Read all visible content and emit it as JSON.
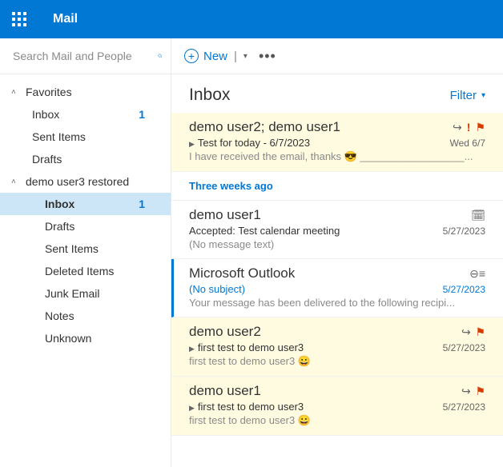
{
  "header": {
    "app_title": "Mail"
  },
  "search": {
    "placeholder": "Search Mail and People"
  },
  "commands": {
    "new_label": "New",
    "divider": "|"
  },
  "sidebar": {
    "sections": [
      {
        "label": "Favorites",
        "folders": [
          {
            "label": "Inbox",
            "count": "1"
          },
          {
            "label": "Sent Items",
            "count": ""
          },
          {
            "label": "Drafts",
            "count": ""
          }
        ]
      },
      {
        "label": "demo user3 restored",
        "folders": [
          {
            "label": "Inbox",
            "count": "1",
            "selected": true
          },
          {
            "label": "Drafts",
            "count": ""
          },
          {
            "label": "Sent Items",
            "count": ""
          },
          {
            "label": "Deleted Items",
            "count": ""
          },
          {
            "label": "Junk Email",
            "count": ""
          },
          {
            "label": "Notes",
            "count": ""
          },
          {
            "label": "Unknown",
            "count": ""
          }
        ]
      }
    ]
  },
  "list": {
    "title": "Inbox",
    "filter_label": "Filter",
    "group_label": "Three weeks ago",
    "messages": [
      {
        "sender": "demo user2; demo user1",
        "subject": "Test for today - 6/7/2023",
        "date": "Wed 6/7",
        "preview": "I have received the email, thanks 😎  __________________...",
        "thread": true,
        "reply": true,
        "importance": true,
        "flag": true
      },
      {
        "sender": "demo user1",
        "subject": "Accepted: Test calendar meeting",
        "date": "5/27/2023",
        "preview": "(No message text)",
        "calendar": true
      },
      {
        "sender": "Microsoft Outlook",
        "subject": "(No subject)",
        "date": "5/27/2023",
        "preview": "Your message has been delivered to the following recipi...",
        "unread": true,
        "subject_link": true,
        "notif": true
      },
      {
        "sender": "demo user2",
        "subject": "first test to demo user3",
        "date": "5/27/2023",
        "preview": "first test to demo user3 😀",
        "thread": true,
        "reply": true,
        "flag": true
      },
      {
        "sender": "demo user1",
        "subject": "first test to demo user3",
        "date": "5/27/2023",
        "preview": "first test to demo user3 😀",
        "thread": true,
        "reply": true,
        "flag": true
      }
    ]
  }
}
